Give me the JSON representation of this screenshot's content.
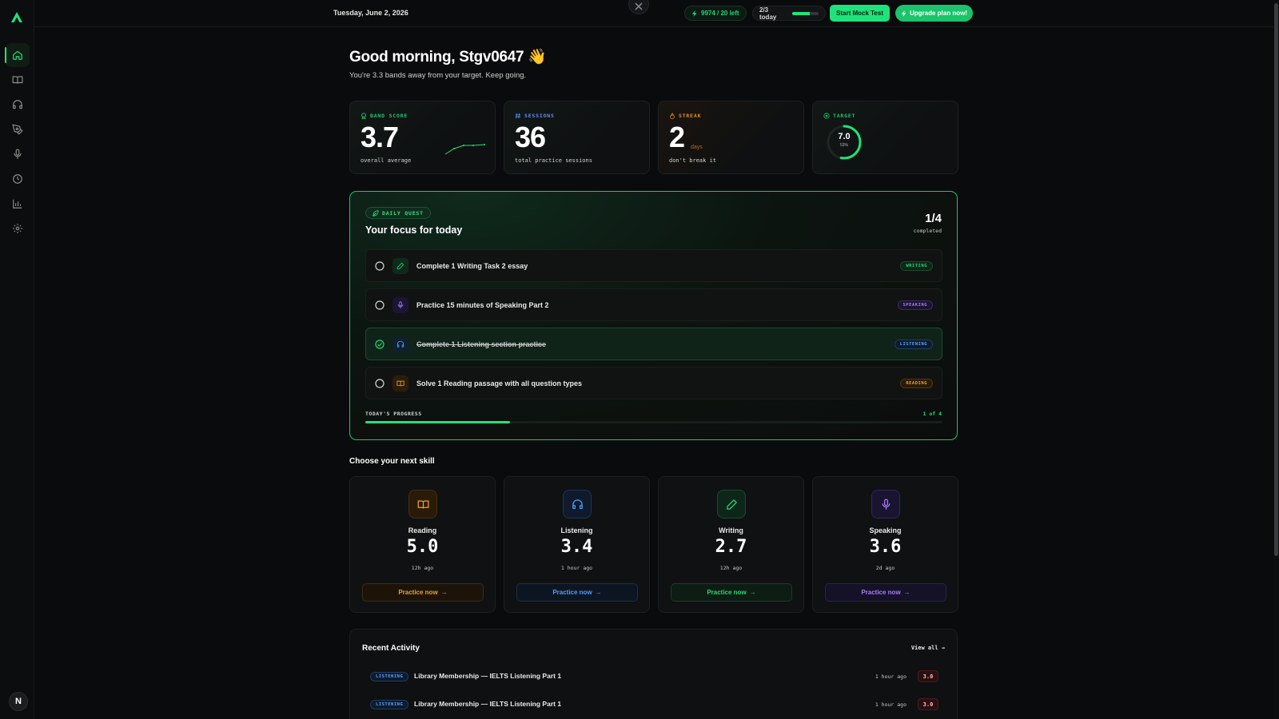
{
  "topbar": {
    "date": "Tuesday, June 2, 2026",
    "credits": "9974 / 20 left",
    "today_label": "2/3 today",
    "today_progress": 0.67,
    "mock_test_label": "Start Mock Test",
    "upgrade_label": "Upgrade plan now!"
  },
  "sidebar": {
    "items": [
      "home-icon",
      "book-icon",
      "headphones-icon",
      "pen-icon",
      "mic-icon",
      "clock-icon",
      "chart-icon",
      "gear-icon"
    ],
    "active": "home-icon",
    "avatar_letter": "N"
  },
  "greeting": {
    "title": "Good morning, Stgv0647 👋",
    "subtitle": "You're 3.3 bands away from your target. Keep going."
  },
  "stats": {
    "band": {
      "label": "BAND SCORE",
      "value": "3.7",
      "sub": "overall average"
    },
    "sessions": {
      "label": "SESSIONS",
      "value": "36",
      "sub": "total practice sessions"
    },
    "streak": {
      "label": "STREAK",
      "value": "2",
      "unit": "days",
      "sub": "don't break it"
    },
    "target": {
      "label": "TARGET",
      "value": "7.0",
      "pct": "53%",
      "progress": 0.53
    }
  },
  "quest": {
    "badge": "DAILY QUEST",
    "title": "Your focus for today",
    "count": "1/4",
    "count_sub": "completed",
    "tasks": [
      {
        "text": "Complete 1 Writing Task 2 essay",
        "tag": "WRITING",
        "done": false
      },
      {
        "text": "Practice 15 minutes of Speaking Part 2",
        "tag": "SPEAKING",
        "done": false
      },
      {
        "text": "Complete 1 Listening section practice",
        "tag": "LISTENING",
        "done": true
      },
      {
        "text": "Solve 1 Reading passage with all question types",
        "tag": "READING",
        "done": false
      }
    ],
    "progress_label": "TODAY'S PROGRESS",
    "progress_count": "1 of 4",
    "progress": 0.25
  },
  "skills": {
    "title": "Choose your next skill",
    "items": [
      {
        "name": "Reading",
        "score": "5.0",
        "time": "12h ago",
        "cta": "Practice now",
        "color": "#f0a22c"
      },
      {
        "name": "Listening",
        "score": "3.4",
        "time": "1 hour ago",
        "cta": "Practice now",
        "color": "#4f9dff"
      },
      {
        "name": "Writing",
        "score": "2.7",
        "time": "12h ago",
        "cta": "Practice now",
        "color": "#24d972"
      },
      {
        "name": "Speaking",
        "score": "3.6",
        "time": "2d ago",
        "cta": "Practice now",
        "color": "#a77bff"
      }
    ]
  },
  "activity": {
    "title": "Recent Activity",
    "view_all": "View all →",
    "rows": [
      {
        "tag": "LISTENING",
        "text": "Library Membership — IELTS Listening Part 1",
        "time": "1 hour ago",
        "score": "3.0"
      },
      {
        "tag": "LISTENING",
        "text": "Library Membership — IELTS Listening Part 1",
        "time": "1 hour ago",
        "score": "3.0"
      }
    ]
  },
  "colors": {
    "accent": "#1ee37a",
    "writing": "#24d972",
    "speaking": "#a77bff",
    "listening": "#4f9dff",
    "reading": "#f0a22c"
  }
}
